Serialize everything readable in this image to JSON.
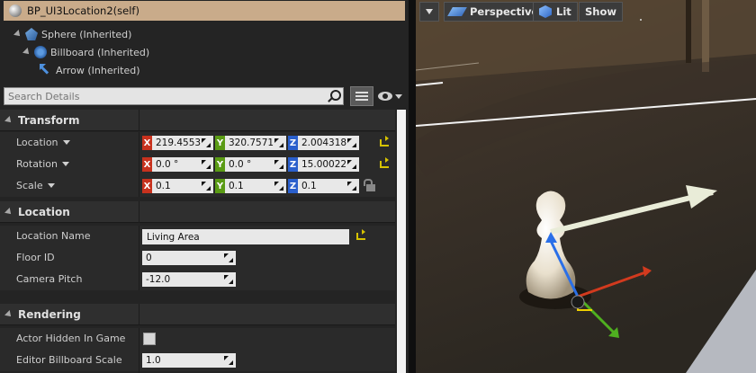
{
  "details": {
    "title": "BP_UI3Location2(self)",
    "tree": [
      {
        "label": "Sphere (Inherited)",
        "icon": "sphere-icon"
      },
      {
        "label": "Billboard (Inherited)",
        "icon": "billboard-icon"
      },
      {
        "label": "Arrow (Inherited)",
        "icon": "arrow-icon"
      }
    ],
    "search_placeholder": "Search Details",
    "transform": {
      "header": "Transform",
      "location_label": "Location",
      "rotation_label": "Rotation",
      "scale_label": "Scale",
      "axis_x": "X",
      "axis_y": "Y",
      "axis_z": "Z",
      "location": [
        "219.4553",
        "320.7571",
        "2.004318"
      ],
      "rotation": [
        "0.0 °",
        "0.0 °",
        "15.00022"
      ],
      "scale": [
        "0.1",
        "0.1",
        "0.1"
      ]
    },
    "location": {
      "header": "Location",
      "name_label": "Location Name",
      "name_value": "Living Area",
      "floor_label": "Floor ID",
      "floor_value": "0",
      "pitch_label": "Camera Pitch",
      "pitch_value": "-12.0"
    },
    "rendering": {
      "header": "Rendering",
      "hidden_label": "Actor Hidden In Game",
      "billboard_label": "Editor Billboard Scale",
      "billboard_value": "1.0"
    }
  },
  "viewport": {
    "perspective_label": "Perspective",
    "lit_label": "Lit",
    "show_label": "Show"
  }
}
